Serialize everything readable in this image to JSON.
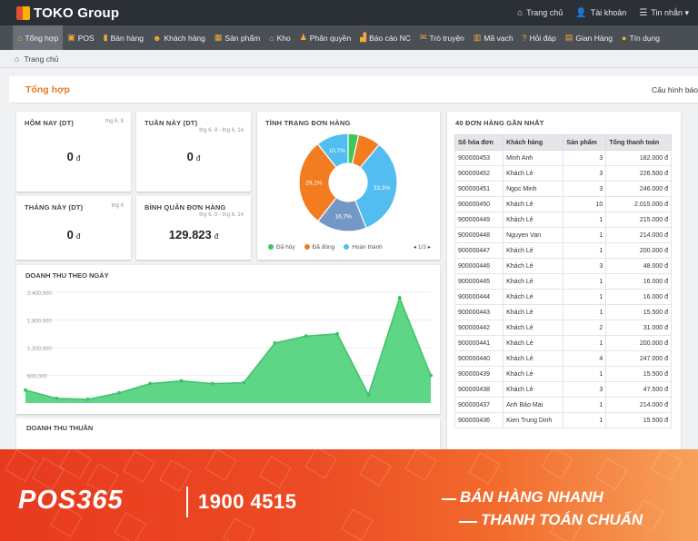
{
  "brand": {
    "name": "TOKO Group"
  },
  "top_nav": [
    {
      "icon": "home-icon",
      "glyph": "⌂",
      "label": "Trang chủ"
    },
    {
      "icon": "user-icon",
      "glyph": "👤",
      "label": "Tài khoản"
    },
    {
      "icon": "list-icon",
      "glyph": "☰",
      "label": "Tin nhắn ▾"
    }
  ],
  "menu": [
    {
      "icon": "home-icon",
      "glyph": "⌂",
      "label": "Tổng hợp",
      "active": true
    },
    {
      "icon": "pos-icon",
      "glyph": "▣",
      "label": "POS"
    },
    {
      "icon": "bar-chart-icon",
      "glyph": "▮",
      "label": "Bán hàng"
    },
    {
      "icon": "customer-icon",
      "glyph": "☻",
      "label": "Khách hàng"
    },
    {
      "icon": "product-icon",
      "glyph": "▦",
      "label": "Sản phẩm"
    },
    {
      "icon": "warehouse-icon",
      "glyph": "⌂",
      "label": "Kho"
    },
    {
      "icon": "permission-icon",
      "glyph": "♟",
      "label": "Phân quyền"
    },
    {
      "icon": "report-icon",
      "glyph": "▟",
      "label": "Báo cáo NC"
    },
    {
      "icon": "chat-icon",
      "glyph": "✉",
      "label": "Trò truyện"
    },
    {
      "icon": "barcode-icon",
      "glyph": "▥",
      "label": "Mã vạch"
    },
    {
      "icon": "help-icon",
      "glyph": "?",
      "label": "Hỏi đáp"
    },
    {
      "icon": "store-icon",
      "glyph": "▤",
      "label": "Gian Hàng"
    },
    {
      "icon": "credit-icon",
      "glyph": "●",
      "label": "Tín dụng"
    }
  ],
  "breadcrumb": {
    "label": "Trang chủ"
  },
  "page": {
    "title": "Tổng hợp",
    "config_label": "Cấu hình báo"
  },
  "stats": {
    "today": {
      "title": "HÔM NAY (DT)",
      "sub": "thg 6, 8",
      "value": "0",
      "currency": "đ"
    },
    "week": {
      "title": "TUẦN NÀY (DT)",
      "sub": "thg 6, 8 - thg 6, 14",
      "value": "0",
      "currency": "đ"
    },
    "month": {
      "title": "THÁNG NÀY (DT)",
      "sub": "thg 6",
      "value": "0",
      "currency": "đ"
    },
    "average": {
      "title": "BÌNH QUÂN ĐƠN HÀNG",
      "sub": "thg 6, 8 - thg 6, 14",
      "value": "129.823",
      "currency": "đ"
    }
  },
  "order_status": {
    "title": "TÌNH TRẠNG ĐƠN HÀNG",
    "legend": [
      {
        "label": "Đã hủy",
        "color": "#3ec65a"
      },
      {
        "label": "Đã đóng",
        "color": "#f47c20"
      },
      {
        "label": "Hoàn thành",
        "color": "#52bdf0"
      }
    ],
    "pager": "1/3"
  },
  "revenue_next_title": "DOANH THU THUẦN",
  "orders": {
    "title": "40 ĐƠN HÀNG GẦN NHẤT",
    "headers": [
      "Số hóa đơn",
      "Khách hàng",
      "Sản phẩm",
      "Tổng thanh toán"
    ],
    "rows": [
      [
        "900000453",
        "Minh Anh",
        "3",
        "182.000 đ"
      ],
      [
        "900000452",
        "Khách Lẻ",
        "3",
        "226.500 đ"
      ],
      [
        "900000451",
        "Ngọc Minh",
        "3",
        "246.000 đ"
      ],
      [
        "900000450",
        "Khách Lẻ",
        "10",
        "2.015.000 đ"
      ],
      [
        "900000449",
        "Khách Lẻ",
        "1",
        "215.000 đ"
      ],
      [
        "900000448",
        "Nguyen Van",
        "1",
        "214.000 đ"
      ],
      [
        "900000447",
        "Khách Lẻ",
        "1",
        "200.000 đ"
      ],
      [
        "900000446",
        "Khách Lẻ",
        "3",
        "48.000 đ"
      ],
      [
        "900000445",
        "Khách Lẻ",
        "1",
        "16.000 đ"
      ],
      [
        "900000444",
        "Khách Lẻ",
        "1",
        "16.000 đ"
      ],
      [
        "900000443",
        "Khách Lẻ",
        "1",
        "15.500 đ"
      ],
      [
        "900000442",
        "Khách Lẻ",
        "2",
        "31.000 đ"
      ],
      [
        "900000441",
        "Khách Lẻ",
        "1",
        "200.000 đ"
      ],
      [
        "900000440",
        "Khách Lẻ",
        "4",
        "247.000 đ"
      ],
      [
        "900000439",
        "Khách Lẻ",
        "1",
        "15.500 đ"
      ],
      [
        "900000438",
        "Khách Lẻ",
        "3",
        "47.500 đ"
      ],
      [
        "900000437",
        "Anh Bảo Mai",
        "1",
        "214.000 đ"
      ],
      [
        "900000436",
        "Kien Trung Dinh",
        "1",
        "15.500 đ"
      ]
    ]
  },
  "banner": {
    "brand": "POS365",
    "phone": "1900 4515",
    "slogan1": "BÁN HÀNG NHANH",
    "slogan2": "THANH TOÁN CHUẨN"
  },
  "chart_data": [
    {
      "type": "pie",
      "title": "TÌNH TRẠNG ĐƠN HÀNG",
      "slices": [
        {
          "label": "Đã hủy",
          "value": 3.5,
          "color": "#3ec65a",
          "show_label": false
        },
        {
          "label": "",
          "value": 7.5,
          "color": "#f47c20",
          "show_label": false
        },
        {
          "label": "Hoàn thành",
          "value": 33.3,
          "color": "#52bdf0",
          "show_label": true
        },
        {
          "label": "",
          "value": 16.7,
          "color": "#7498c6",
          "show_label": true
        },
        {
          "label": "Đã đóng",
          "value": 29.1,
          "color": "#f47c20",
          "show_label": true
        },
        {
          "label": "",
          "value": 10.7,
          "color": "#52bdf0",
          "show_label": true
        }
      ]
    },
    {
      "type": "area",
      "title": "DOANH THU THEO NGÀY",
      "ylim": [
        0,
        2400000
      ],
      "yticks": [
        {
          "value": 2400000,
          "label": "2.400.000"
        },
        {
          "value": 1800000,
          "label": "1.800.000"
        },
        {
          "value": 1200000,
          "label": "1.200.000"
        },
        {
          "value": 600000,
          "label": "600.000"
        }
      ],
      "values": [
        280000,
        100000,
        80000,
        220000,
        420000,
        480000,
        420000,
        440000,
        1300000,
        1450000,
        1500000,
        180000,
        2280000,
        600000
      ],
      "color": "#5fd685",
      "line_color": "#3fc26a"
    }
  ]
}
